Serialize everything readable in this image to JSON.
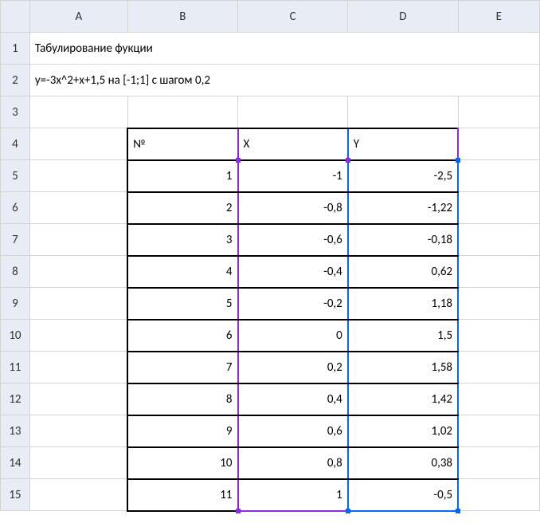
{
  "columns": [
    "A",
    "B",
    "C",
    "D",
    "E"
  ],
  "rowNumbers": [
    1,
    2,
    3,
    4,
    5,
    6,
    7,
    8,
    9,
    10,
    11,
    12,
    13,
    14,
    15
  ],
  "title1": "Табулирование фукции",
  "title2": "y=-3x^2+x+1,5 на [-1;1] с шагом 0,2",
  "headers": {
    "no": "№",
    "x": "X",
    "y": "Y"
  },
  "rows": [
    {
      "n": "1",
      "x": "-1",
      "y": "-2,5"
    },
    {
      "n": "2",
      "x": "-0,8",
      "y": "-1,22"
    },
    {
      "n": "3",
      "x": "-0,6",
      "y": "-0,18"
    },
    {
      "n": "4",
      "x": "-0,4",
      "y": "0,62"
    },
    {
      "n": "5",
      "x": "-0,2",
      "y": "1,18"
    },
    {
      "n": "6",
      "x": "0",
      "y": "1,5"
    },
    {
      "n": "7",
      "x": "0,2",
      "y": "1,58"
    },
    {
      "n": "8",
      "x": "0,4",
      "y": "1,42"
    },
    {
      "n": "9",
      "x": "0,6",
      "y": "1,02"
    },
    {
      "n": "10",
      "x": "0,8",
      "y": "0,38"
    },
    {
      "n": "11",
      "x": "1",
      "y": "-0,5"
    }
  ],
  "chart_data": {
    "type": "table",
    "title": "Табулирование фукции",
    "formula": "y=-3x^2+x+1,5",
    "interval": "[-1;1]",
    "step": 0.2,
    "x": [
      -1,
      -0.8,
      -0.6,
      -0.4,
      -0.2,
      0,
      0.2,
      0.4,
      0.6,
      0.8,
      1
    ],
    "y": [
      -2.5,
      -1.22,
      -0.18,
      0.62,
      1.18,
      1.5,
      1.58,
      1.42,
      1.02,
      0.38,
      -0.5
    ]
  }
}
